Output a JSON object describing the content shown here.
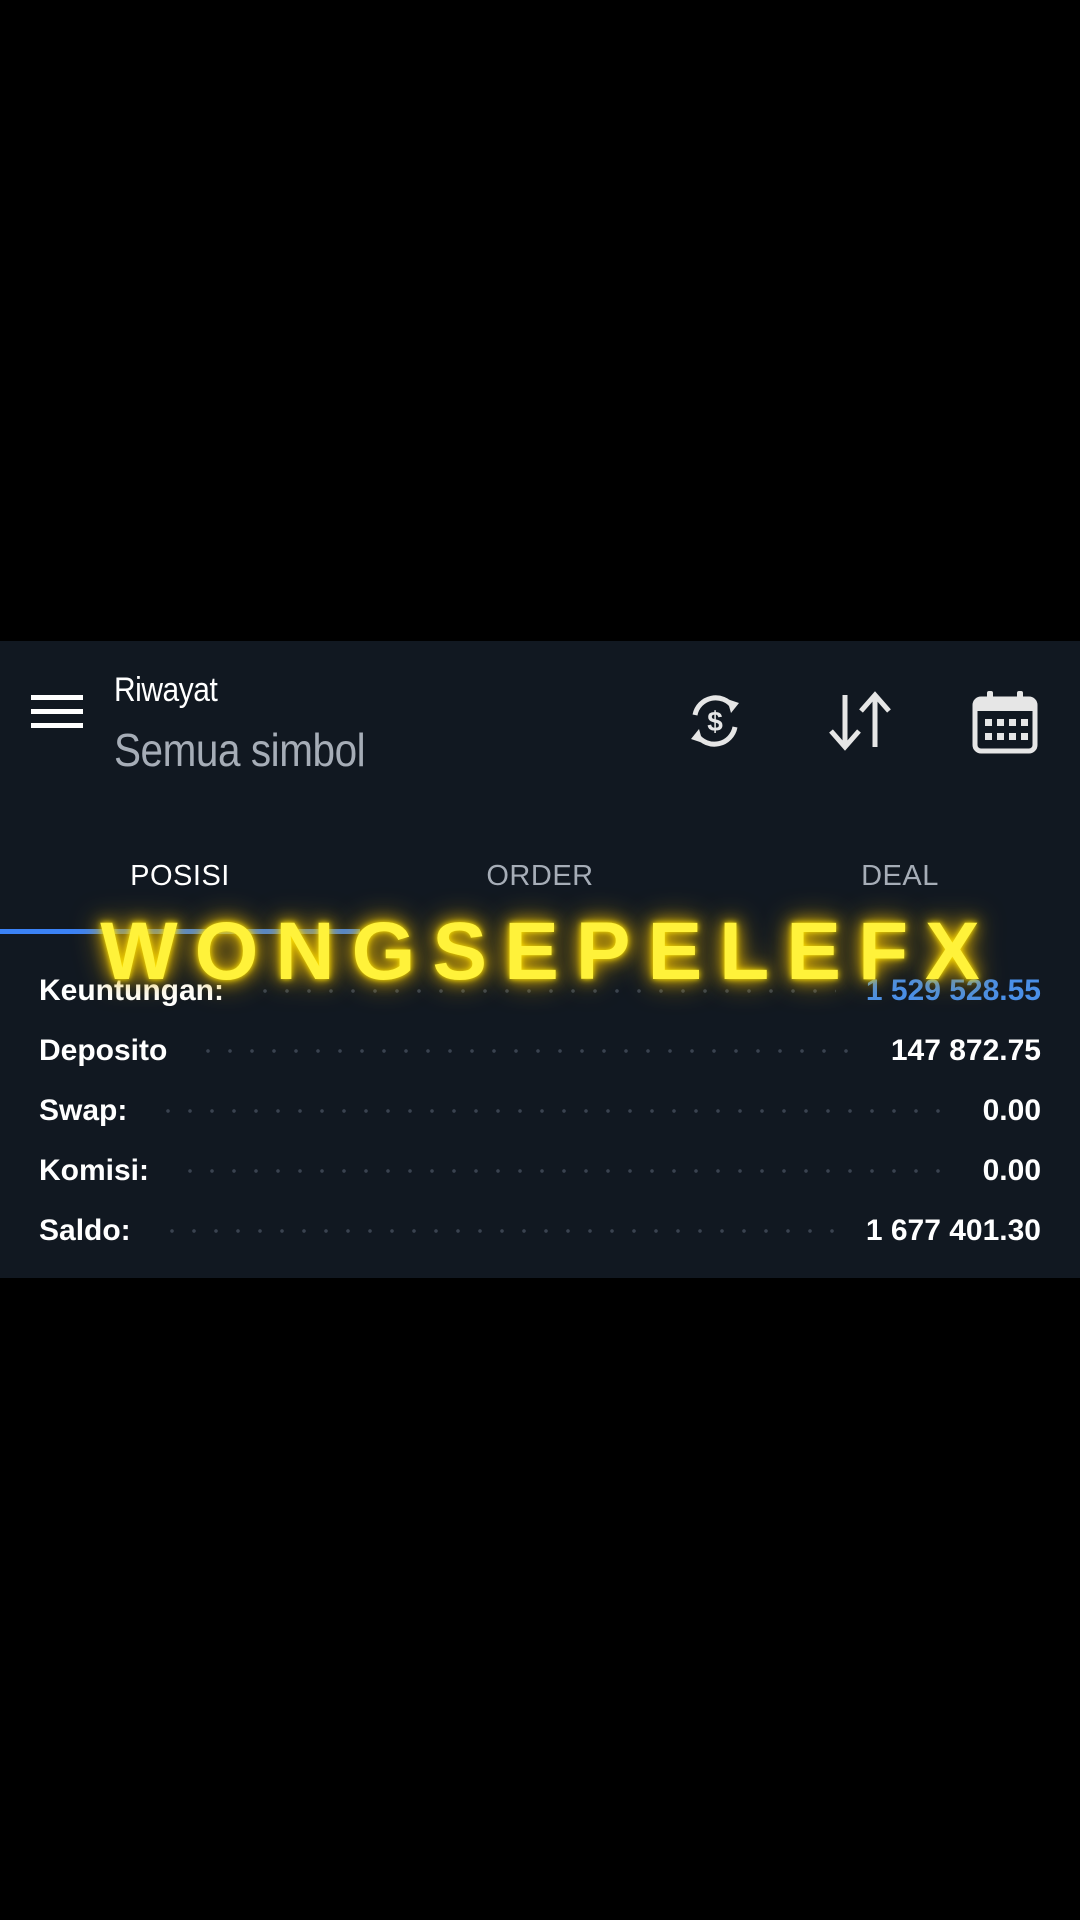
{
  "toolbar": {
    "title": "Riwayat",
    "subtitle": "Semua simbol",
    "icons": {
      "menu": "hamburger-menu-icon",
      "currency": "currency-refresh-icon",
      "sort": "sort-arrows-icon",
      "calendar": "calendar-icon"
    }
  },
  "tabs": [
    {
      "label": "POSISI",
      "active": true
    },
    {
      "label": "ORDER",
      "active": false
    },
    {
      "label": "DEAL",
      "active": false
    }
  ],
  "summary": [
    {
      "label": "Keuntungan:",
      "value": "1 529 528.55",
      "accent": true
    },
    {
      "label": "Deposito",
      "value": "147 872.75"
    },
    {
      "label": "Swap:",
      "value": "0.00"
    },
    {
      "label": "Komisi:",
      "value": "0.00"
    },
    {
      "label": "Saldo:",
      "value": "1 677 401.30"
    }
  ],
  "watermark": "WONGSEPELEFX",
  "colors": {
    "panel_background": "#111821",
    "accent_blue": "#4a8fe7",
    "tab_indicator": "#3b82f6",
    "watermark_yellow": "#fff23a"
  }
}
